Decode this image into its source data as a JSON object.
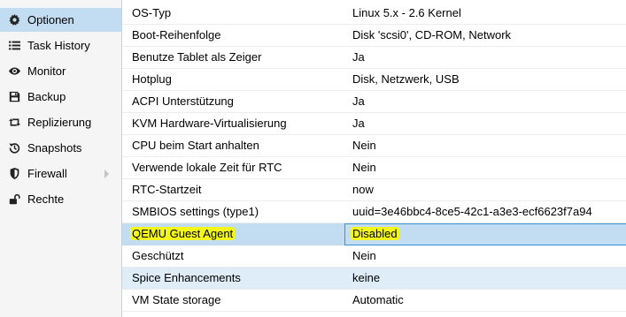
{
  "sidebar": {
    "items": [
      {
        "label": "Optionen",
        "icon": "gear-icon",
        "active": true
      },
      {
        "label": "Task History",
        "icon": "list-icon"
      },
      {
        "label": "Monitor",
        "icon": "eye-icon"
      },
      {
        "label": "Backup",
        "icon": "floppy-disk-icon"
      },
      {
        "label": "Replizierung",
        "icon": "retweet-icon"
      },
      {
        "label": "Snapshots",
        "icon": "history-icon"
      },
      {
        "label": "Firewall",
        "icon": "shield-icon",
        "has_submenu": true
      },
      {
        "label": "Rechte",
        "icon": "unlock-icon"
      }
    ]
  },
  "options": {
    "rows": [
      {
        "key": "OS-Typ",
        "value": "Linux 5.x - 2.6 Kernel"
      },
      {
        "key": "Boot-Reihenfolge",
        "value": "Disk 'scsi0', CD-ROM, Network"
      },
      {
        "key": "Benutze Tablet als Zeiger",
        "value": "Ja"
      },
      {
        "key": "Hotplug",
        "value": "Disk, Netzwerk, USB"
      },
      {
        "key": "ACPI Unterstützung",
        "value": "Ja"
      },
      {
        "key": "KVM Hardware-Virtualisierung",
        "value": "Ja"
      },
      {
        "key": "CPU beim Start anhalten",
        "value": "Nein"
      },
      {
        "key": "Verwende lokale Zeit für RTC",
        "value": "Nein"
      },
      {
        "key": "RTC-Startzeit",
        "value": "now"
      },
      {
        "key": "SMBIOS settings (type1)",
        "value": "uuid=3e46bbc4-8ce5-42c1-a3e3-ecf6623f7a94"
      },
      {
        "key": "QEMU Guest Agent",
        "value": "Disabled",
        "selected": true
      },
      {
        "key": "Geschützt",
        "value": "Nein"
      },
      {
        "key": "Spice Enhancements",
        "value": "keine"
      },
      {
        "key": "VM State storage",
        "value": "Automatic"
      }
    ]
  },
  "colors": {
    "selection": "#c2ddf2",
    "highlight": "#f3f71a",
    "focus_border": "#3892d4"
  }
}
